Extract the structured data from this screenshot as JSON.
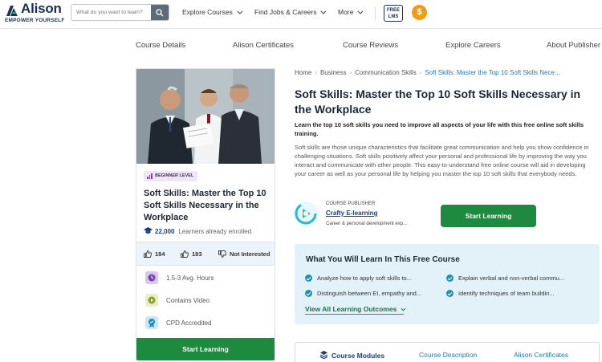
{
  "header": {
    "logo_name": "Alison",
    "logo_tagline": "EMPOWER YOURSELF",
    "search_placeholder": "What do you want to learn?",
    "nav": [
      {
        "label": "Explore Courses"
      },
      {
        "label": "Find Jobs & Careers"
      },
      {
        "label": "More"
      }
    ],
    "lms_badge": "FREE LMS",
    "dollar_symbol": "$"
  },
  "subnav": [
    {
      "label": "Course Details"
    },
    {
      "label": "Alison Certificates"
    },
    {
      "label": "Course Reviews"
    },
    {
      "label": "Explore Careers"
    },
    {
      "label": "About Publisher"
    }
  ],
  "card": {
    "level": "BEGINNER LEVEL",
    "title": "Soft Skills: Master the Top 10 Soft Skills Necessary in the Workplace",
    "learners_count": "22,000",
    "learners_text": "Learners already enrolled",
    "likes": "184",
    "shares": "183",
    "not_interested": "Not Interested",
    "features": [
      {
        "label": "1.5-3 Avg. Hours",
        "icon": "clock-icon",
        "color": "#dcc6ef"
      },
      {
        "label": "Contains Video",
        "icon": "play-icon",
        "color": "#e6eec5"
      },
      {
        "label": "CPD Accredited",
        "icon": "award-icon",
        "color": "#cde6f3"
      }
    ],
    "cta": "Start Learning"
  },
  "main": {
    "breadcrumb": [
      "Home",
      "Business",
      "Communication Skills",
      "Soft Skills: Master the Top 10 Soft Skills Nece..."
    ],
    "title": "Soft Skills: Master the Top 10 Soft Skills Necessary in the Workplace",
    "subtitle": "Learn the top 10 soft skills you need to improve all aspects of your life with this free online soft skills training.",
    "description": "Soft skills are those unique characteristics that facilitate great communication and help you show confidence in challenging situations. Soft skills positively affect your personal and professional life by improving the way you interact and communicate with other people. This easy-to-understand free online course will aid in developing your career as well as your personal life by helping you master the top 10 soft skills that everybody needs.",
    "publisher_label": "COURSE PUBLISHER",
    "publisher_name": "Crafty E-learning",
    "publisher_tagline": "Career & personal development exp...",
    "cta": "Start Learning"
  },
  "learn": {
    "title": "What You Will Learn In This Free Course",
    "items": [
      "Analyze how to apply soft skills to...",
      "Explain verbal and non-verbal commu...",
      "Distinguish between EI, empathy and...",
      "Identify techniques of team buildin..."
    ],
    "link": "View All Learning Outcomes"
  },
  "tabs": [
    {
      "label": "Course Modules",
      "active": true
    },
    {
      "label": "Course Description",
      "active": false
    },
    {
      "label": "Alison Certificates",
      "active": false
    }
  ],
  "colors": {
    "brand_navy": "#1a3150",
    "cta_green": "#1e8a3f",
    "link_blue": "#2479b5",
    "learn_bg": "#e3f2f8",
    "dollar_orange": "#f39c12"
  }
}
